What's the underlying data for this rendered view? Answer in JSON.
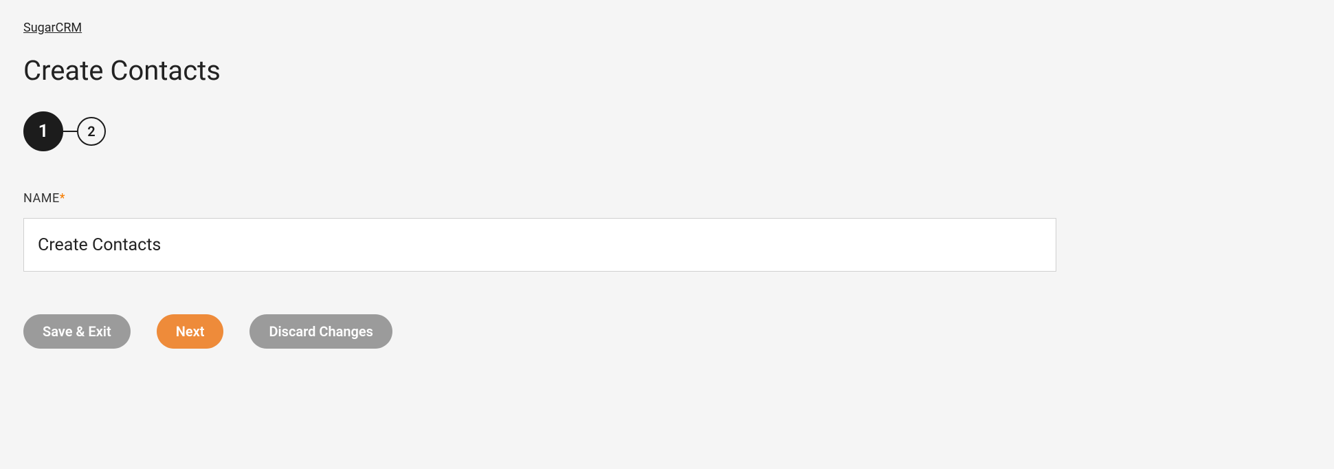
{
  "breadcrumb": {
    "label": "SugarCRM"
  },
  "page": {
    "title": "Create Contacts"
  },
  "stepper": {
    "steps": [
      "1",
      "2"
    ],
    "active_index": 0
  },
  "form": {
    "name": {
      "label": "NAME",
      "required_marker": "*",
      "value": "Create Contacts"
    }
  },
  "buttons": {
    "save_exit": "Save & Exit",
    "next": "Next",
    "discard": "Discard Changes"
  }
}
